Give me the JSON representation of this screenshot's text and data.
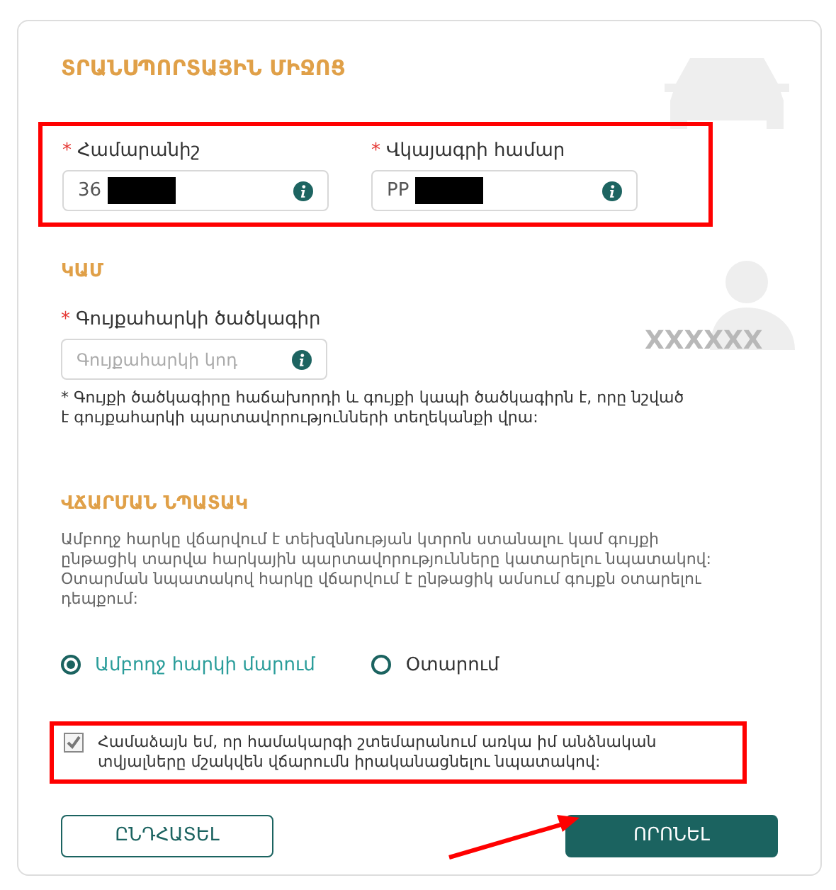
{
  "section_title": "ՏՐԱՆՍՊՈՐՏԱՅԻՆ ՄԻՋՈՑ",
  "plate_fields": [
    {
      "marker": "*",
      "label": "Համարանիշ",
      "value": "36"
    },
    {
      "marker": "*",
      "label": "Վկայագրի համար",
      "value": "PP"
    }
  ],
  "or_label": "ԿԱՄ",
  "watermark_text": "XXXXXX",
  "property_field": {
    "marker": "*",
    "label": "Գույքահարկի ծածկագիր",
    "placeholder": "Գույքահարկի կոդ"
  },
  "note": "* Գույքի ծածկագիրը հաճախորդի և գույքի կապի ծածկագիրն է, որը նշված է գույքահարկի պարտավորությունների տեղեկանքի վրա:",
  "purpose": {
    "title": "ՎՃԱՐՄԱՆ ՆՊԱՏԱԿ",
    "description": "Ամբողջ հարկը վճարվում է տեխզննության կտրոն ստանալու կամ գույքի ընթացիկ տարվա հարկային պարտավորությունները կատարելու նպատակով: Օտարման նպատակով հարկը վճարվում է ընթացիկ ամսում գույքն օտարելու դեպքում:",
    "options": [
      {
        "label": "Ամբողջ հարկի մարում",
        "selected": true
      },
      {
        "label": "Օտարում",
        "selected": false
      }
    ]
  },
  "consent": {
    "text": "Համաձայն եմ, որ համակարգի շտեմարանում առկա իմ անձնական տվյալները մշակվեն վճարումն իրականացնելու նպատակով:",
    "checked": true
  },
  "buttons": [
    {
      "label": "ԸՆԴՀԱՏԵԼ",
      "kind": "secondary"
    },
    {
      "label": "ՈՐՈՆԵԼ",
      "kind": "primary"
    }
  ]
}
